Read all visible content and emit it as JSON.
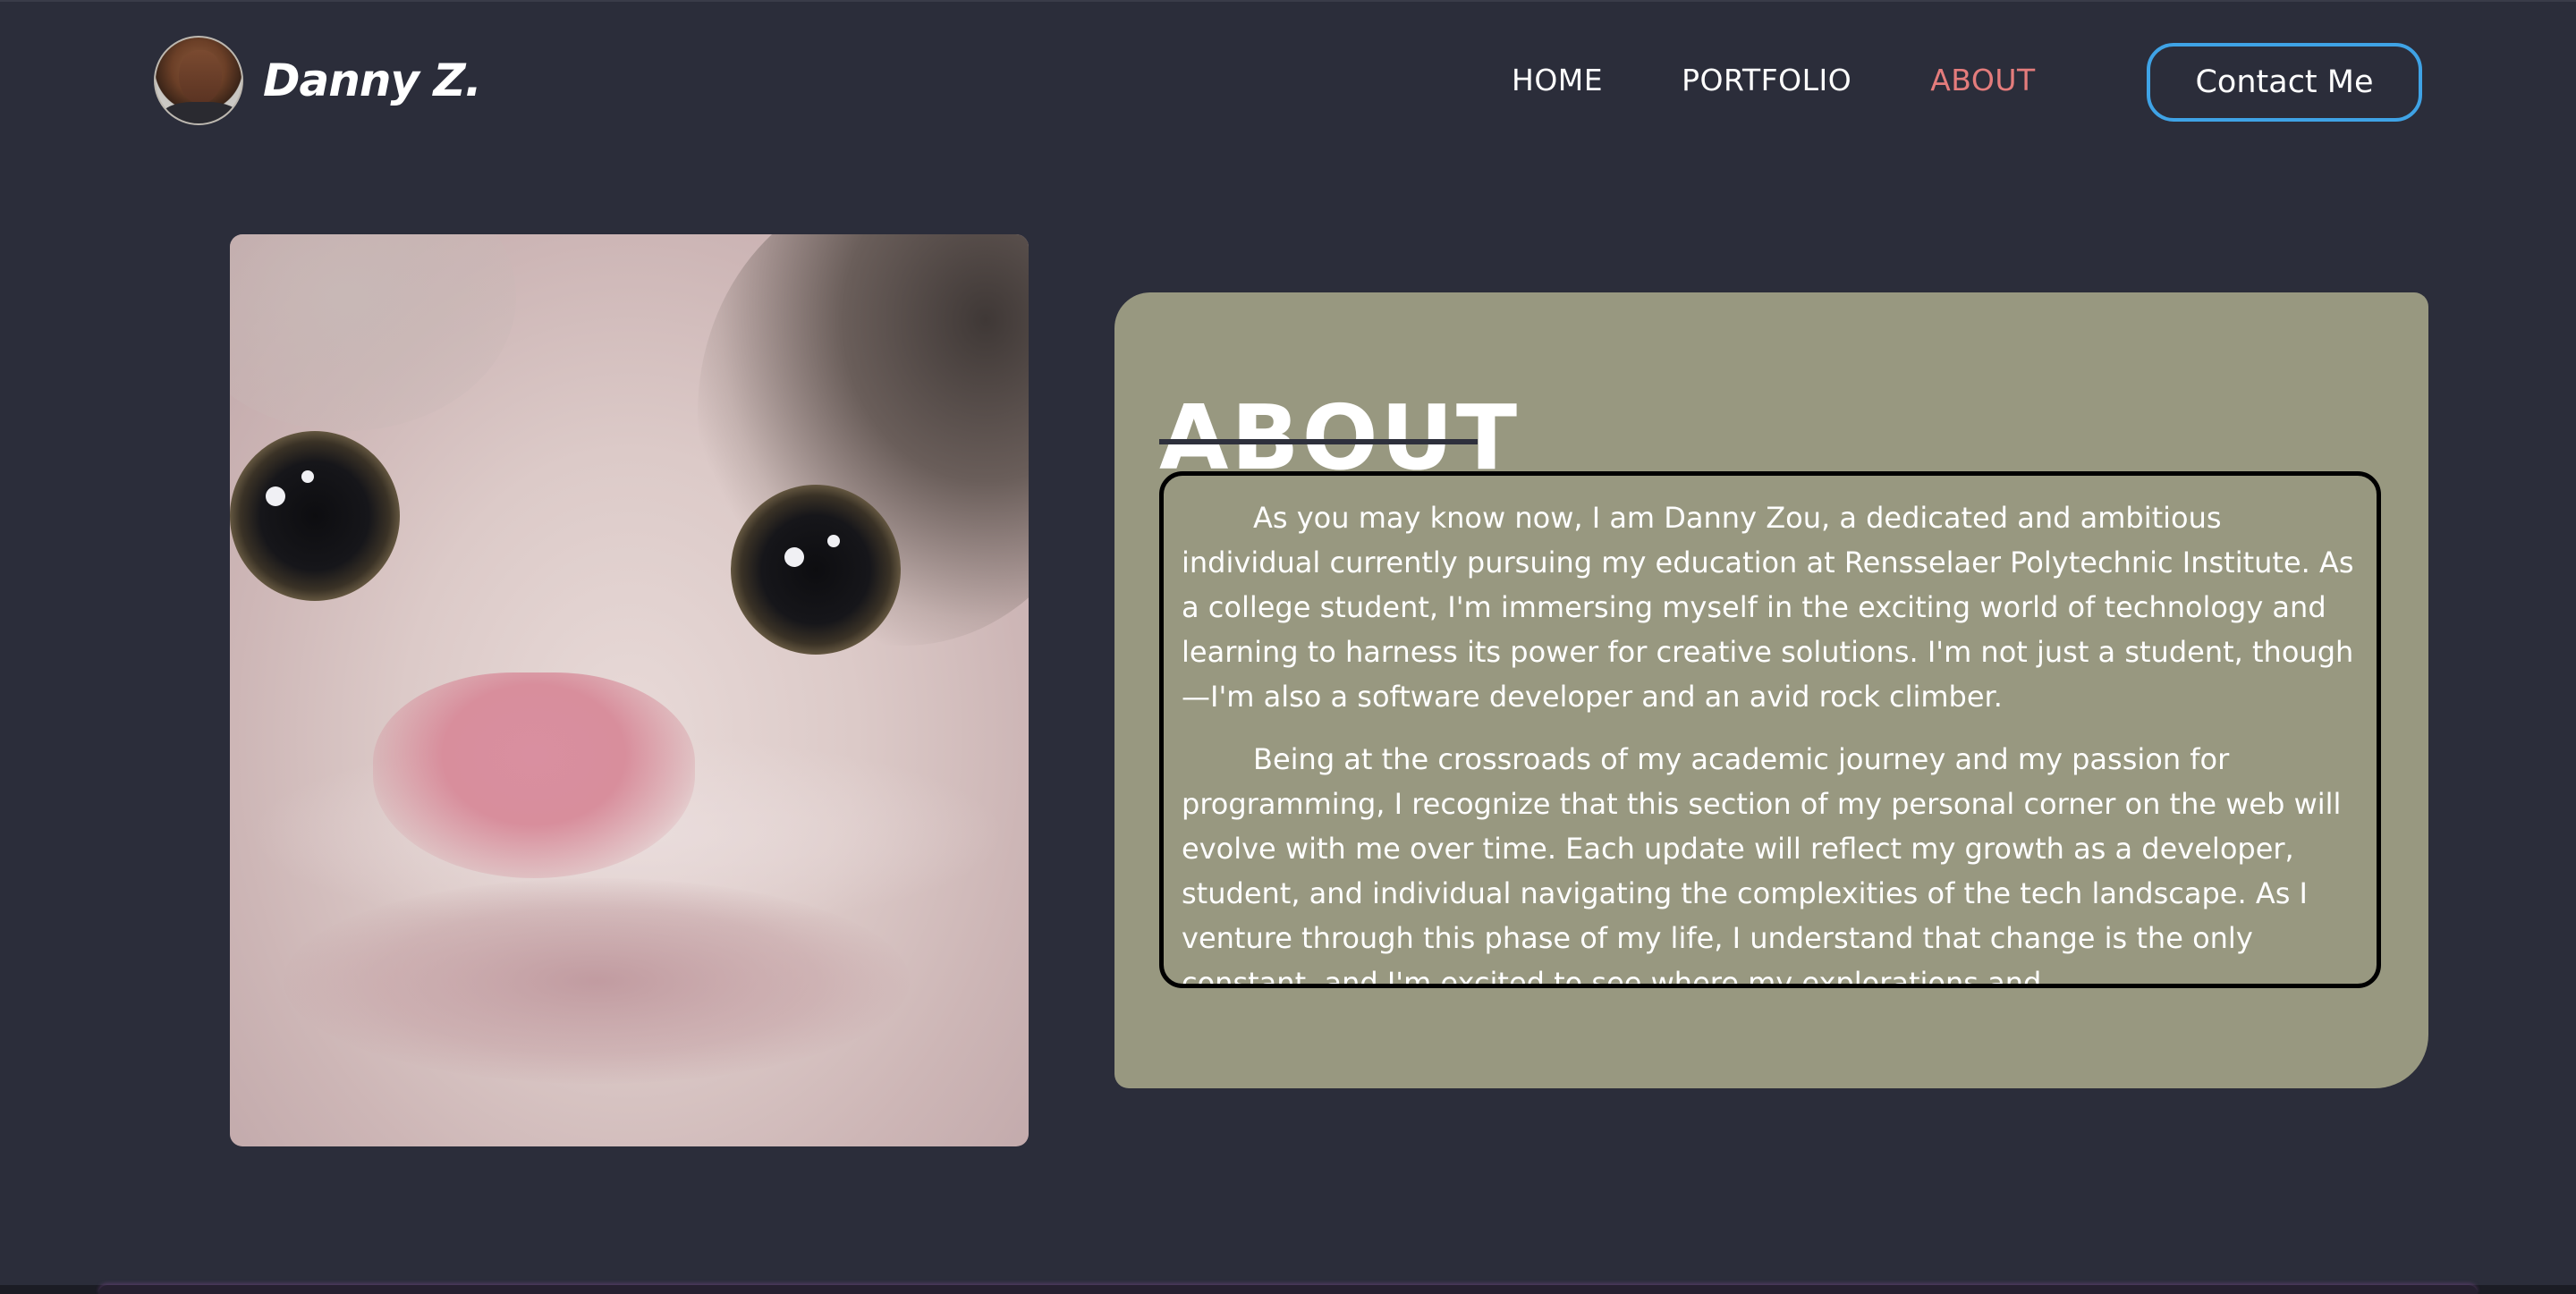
{
  "brand": {
    "name": "Danny Z.",
    "avatar_icon": "avatar-photo"
  },
  "nav": {
    "items": [
      {
        "label": "HOME",
        "active": false
      },
      {
        "label": "PORTFOLIO",
        "active": false
      },
      {
        "label": "ABOUT",
        "active": true
      }
    ],
    "contact_label": "Contact Me"
  },
  "about": {
    "title": "ABOUT",
    "paragraphs": [
      "As you may know now, I am Danny Zou, a dedicated and ambitious individual currently pursuing my education at Rensselaer Polytechnic Institute. As a college student, I'm immersing myself in the exciting world of technology and learning to harness its power for creative solutions. I'm not just a student, though—I'm also a software developer and an avid rock climber.",
      "Being at the crossroads of my academic journey and my passion for programming, I recognize that this section of my personal corner on the web will evolve with me over time. Each update will reflect my growth as a developer, student, and individual navigating the complexities of the tech landscape. As I venture through this phase of my life, I understand that change is the only constant, and I'm excited to see where my explorations and"
    ]
  },
  "colors": {
    "background": "#2b2d3a",
    "accent_active": "#e47c7c",
    "contact_border": "#3fa3e6",
    "card": "#989880"
  }
}
